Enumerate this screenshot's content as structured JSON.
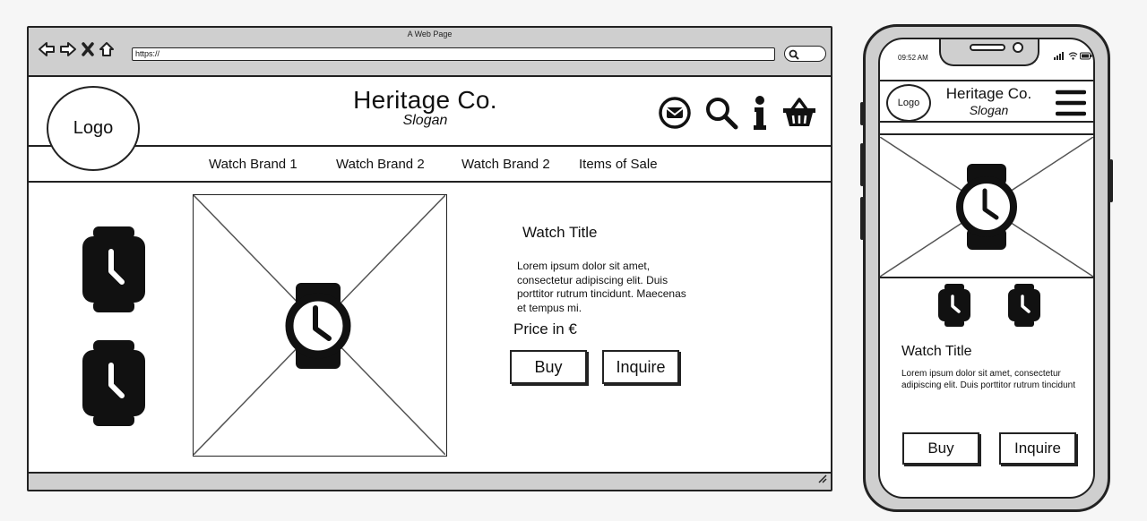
{
  "browser": {
    "title": "A Web Page",
    "url": "https://"
  },
  "site": {
    "logo": "Logo",
    "name": "Heritage Co.",
    "slogan": "Slogan"
  },
  "nav": [
    "Watch Brand 1",
    "Watch Brand 2",
    "Watch Brand 2",
    "Items of Sale"
  ],
  "product": {
    "title": "Watch Title",
    "description": "Lorem ipsum dolor sit amet, consectetur adipiscing elit. Duis porttitor rutrum tincidunt. Maecenas et tempus mi.",
    "price": "Price in €",
    "buy_label": "Buy",
    "inquire_label": "Inquire"
  },
  "mobile": {
    "time": "09:52 AM",
    "logo": "Logo",
    "name": "Heritage Co.",
    "slogan": "Slogan",
    "title": "Watch Title",
    "description": "Lorem ipsum dolor sit amet, consectetur adipiscing elit. Duis porttitor rutrum tincidunt",
    "buy_label": "Buy",
    "inquire_label": "Inquire"
  },
  "icons": {
    "back": "arrow-left-icon",
    "forward": "arrow-right-icon",
    "close": "close-icon",
    "home": "home-icon",
    "mail": "mail-icon",
    "search": "search-icon",
    "info": "info-icon",
    "cart": "basket-icon",
    "watch": "watch-icon",
    "menu": "hamburger-icon"
  }
}
